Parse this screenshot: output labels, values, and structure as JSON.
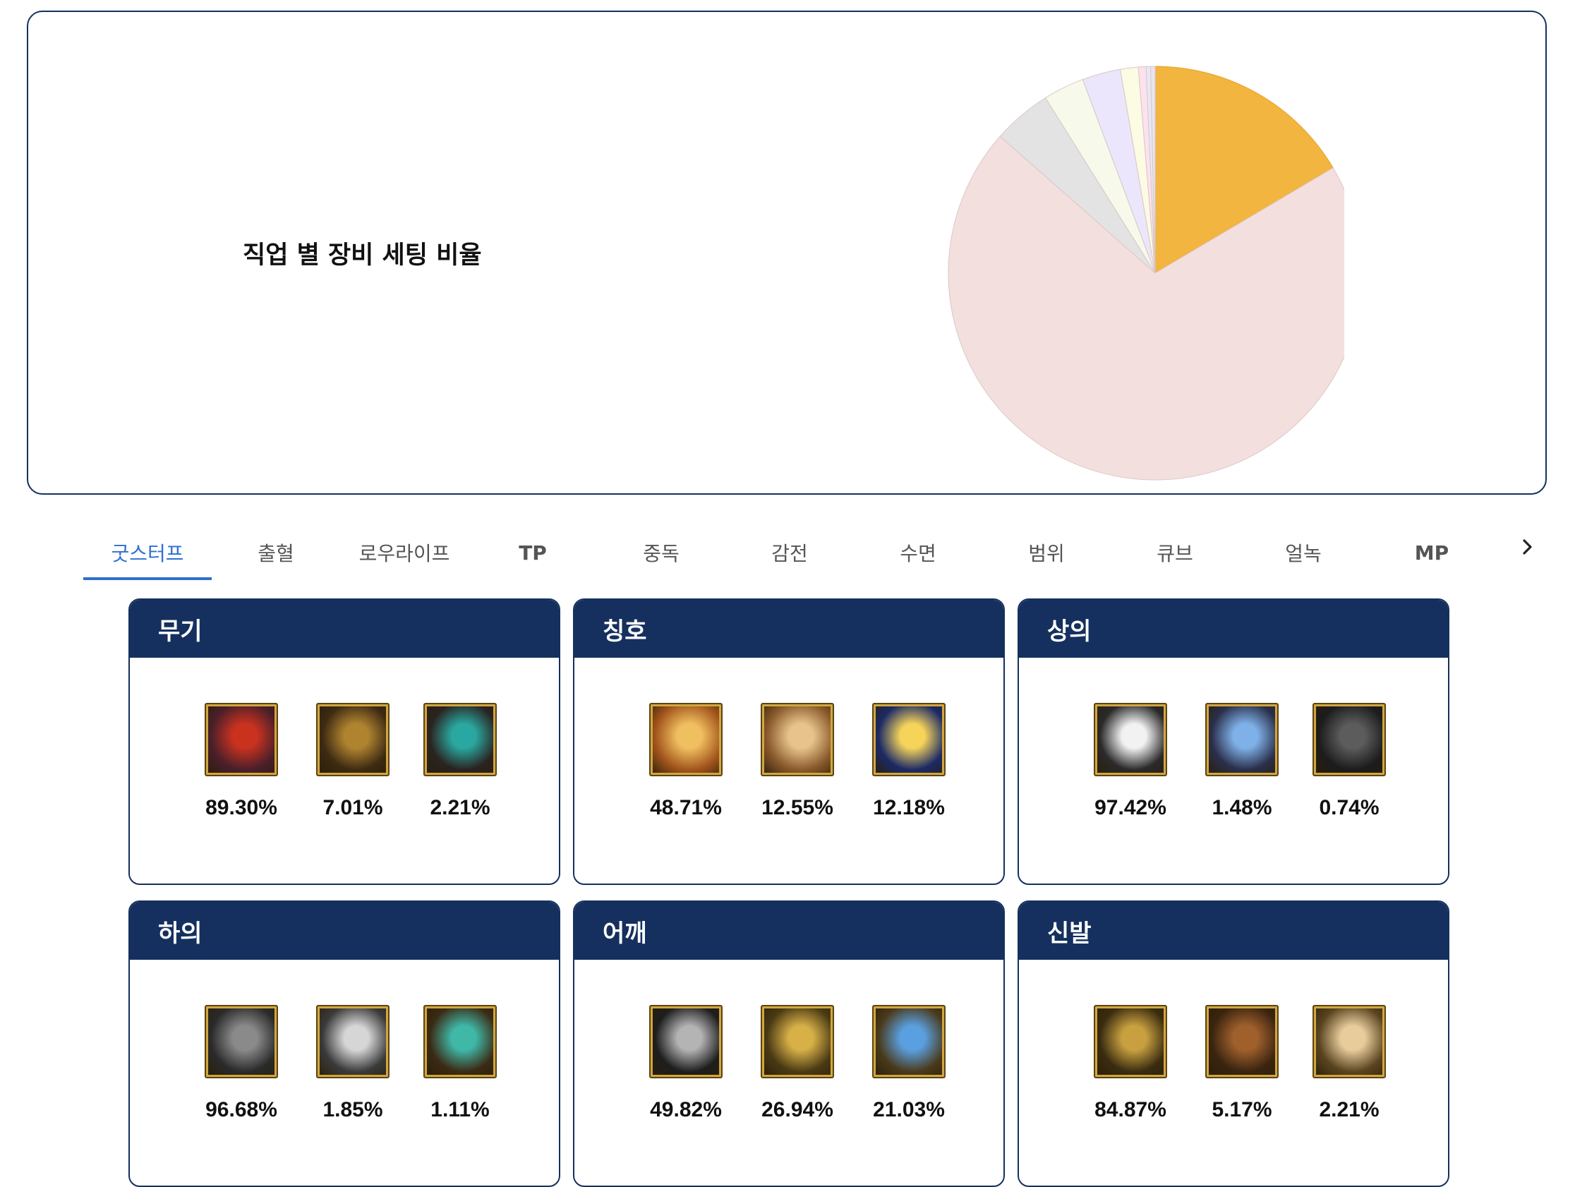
{
  "chart_data": {
    "type": "pie",
    "title": "직업 별 장비 세팅 비율",
    "series": [
      {
        "value": 16.5,
        "color": "#f2b53f"
      },
      {
        "value": 70.0,
        "color": "#f4dfdf"
      },
      {
        "value": 4.6,
        "color": "#e3e3e3"
      },
      {
        "value": 3.2,
        "color": "#f7faea"
      },
      {
        "value": 3.0,
        "color": "#ebe6fb"
      },
      {
        "value": 1.4,
        "color": "#fcfbe3"
      },
      {
        "value": 0.6,
        "color": "#fbe2ee"
      },
      {
        "value": 0.35,
        "color": "#e4e9f8"
      },
      {
        "value": 0.35,
        "color": "#e9e4f2"
      }
    ]
  },
  "tabs": [
    {
      "label": "굿스터프",
      "active": true
    },
    {
      "label": "출혈"
    },
    {
      "label": "로우라이프"
    },
    {
      "label": "TP"
    },
    {
      "label": "중독"
    },
    {
      "label": "감전"
    },
    {
      "label": "수면"
    },
    {
      "label": "범위"
    },
    {
      "label": "큐브"
    },
    {
      "label": "얼녹"
    },
    {
      "label": "MP"
    }
  ],
  "tabs_next_icon": "chevron-right-icon",
  "colors": {
    "header": "#15305e",
    "accent": "#2f6fd0"
  },
  "cards": [
    {
      "title": "무기",
      "items": [
        {
          "pct": "89.30%",
          "icon": "dragon-weapon-icon",
          "c1": "#4a1f2a",
          "c2": "#c9321f"
        },
        {
          "pct": "7.01%",
          "icon": "gold-spear-icon",
          "c1": "#3d2a12",
          "c2": "#b08330"
        },
        {
          "pct": "2.21%",
          "icon": "teal-cannon-icon",
          "c1": "#2a2320",
          "c2": "#2aa7a0"
        }
      ]
    },
    {
      "title": "칭호",
      "items": [
        {
          "pct": "48.71%",
          "icon": "gold-title-icon",
          "c1": "#a3551c",
          "c2": "#f0c060"
        },
        {
          "pct": "12.55%",
          "icon": "bronze-title-icon",
          "c1": "#8a5a2c",
          "c2": "#e8c48c"
        },
        {
          "pct": "12.18%",
          "icon": "star-title-icon",
          "c1": "#1c2a66",
          "c2": "#f6d45a"
        }
      ]
    },
    {
      "title": "상의",
      "items": [
        {
          "pct": "97.42%",
          "icon": "white-coat-icon",
          "c1": "#2a2a2a",
          "c2": "#f2f2f2"
        },
        {
          "pct": "1.48%",
          "icon": "blue-armor-icon",
          "c1": "#2a2f4a",
          "c2": "#7fb0e8"
        },
        {
          "pct": "0.74%",
          "icon": "black-jacket-icon",
          "c1": "#1c1c1c",
          "c2": "#5c5c5c"
        }
      ]
    },
    {
      "title": "하의",
      "items": [
        {
          "pct": "96.68%",
          "icon": "dark-pants-icon",
          "c1": "#2a2a2a",
          "c2": "#8a8a8a"
        },
        {
          "pct": "1.85%",
          "icon": "silver-pants-icon",
          "c1": "#3a3a3a",
          "c2": "#d6d6d6"
        },
        {
          "pct": "1.11%",
          "icon": "teal-pants-icon",
          "c1": "#3b2a14",
          "c2": "#3fb8a8"
        }
      ]
    },
    {
      "title": "어깨",
      "items": [
        {
          "pct": "49.82%",
          "icon": "steel-shoulder-icon",
          "c1": "#1e1e1e",
          "c2": "#b4b4b4"
        },
        {
          "pct": "26.94%",
          "icon": "gold-shoulder-icon",
          "c1": "#4a3a14",
          "c2": "#d8b048"
        },
        {
          "pct": "21.03%",
          "icon": "blue-shoulder-icon",
          "c1": "#4a3a1c",
          "c2": "#5aa0e0"
        }
      ]
    },
    {
      "title": "신발",
      "items": [
        {
          "pct": "84.87%",
          "icon": "gold-boots-icon",
          "c1": "#3a2c10",
          "c2": "#c8a040"
        },
        {
          "pct": "5.17%",
          "icon": "brown-boots-icon",
          "c1": "#3a2410",
          "c2": "#a0602c"
        },
        {
          "pct": "2.21%",
          "icon": "tan-boots-icon",
          "c1": "#5a4420",
          "c2": "#e8cc9c"
        }
      ]
    }
  ]
}
